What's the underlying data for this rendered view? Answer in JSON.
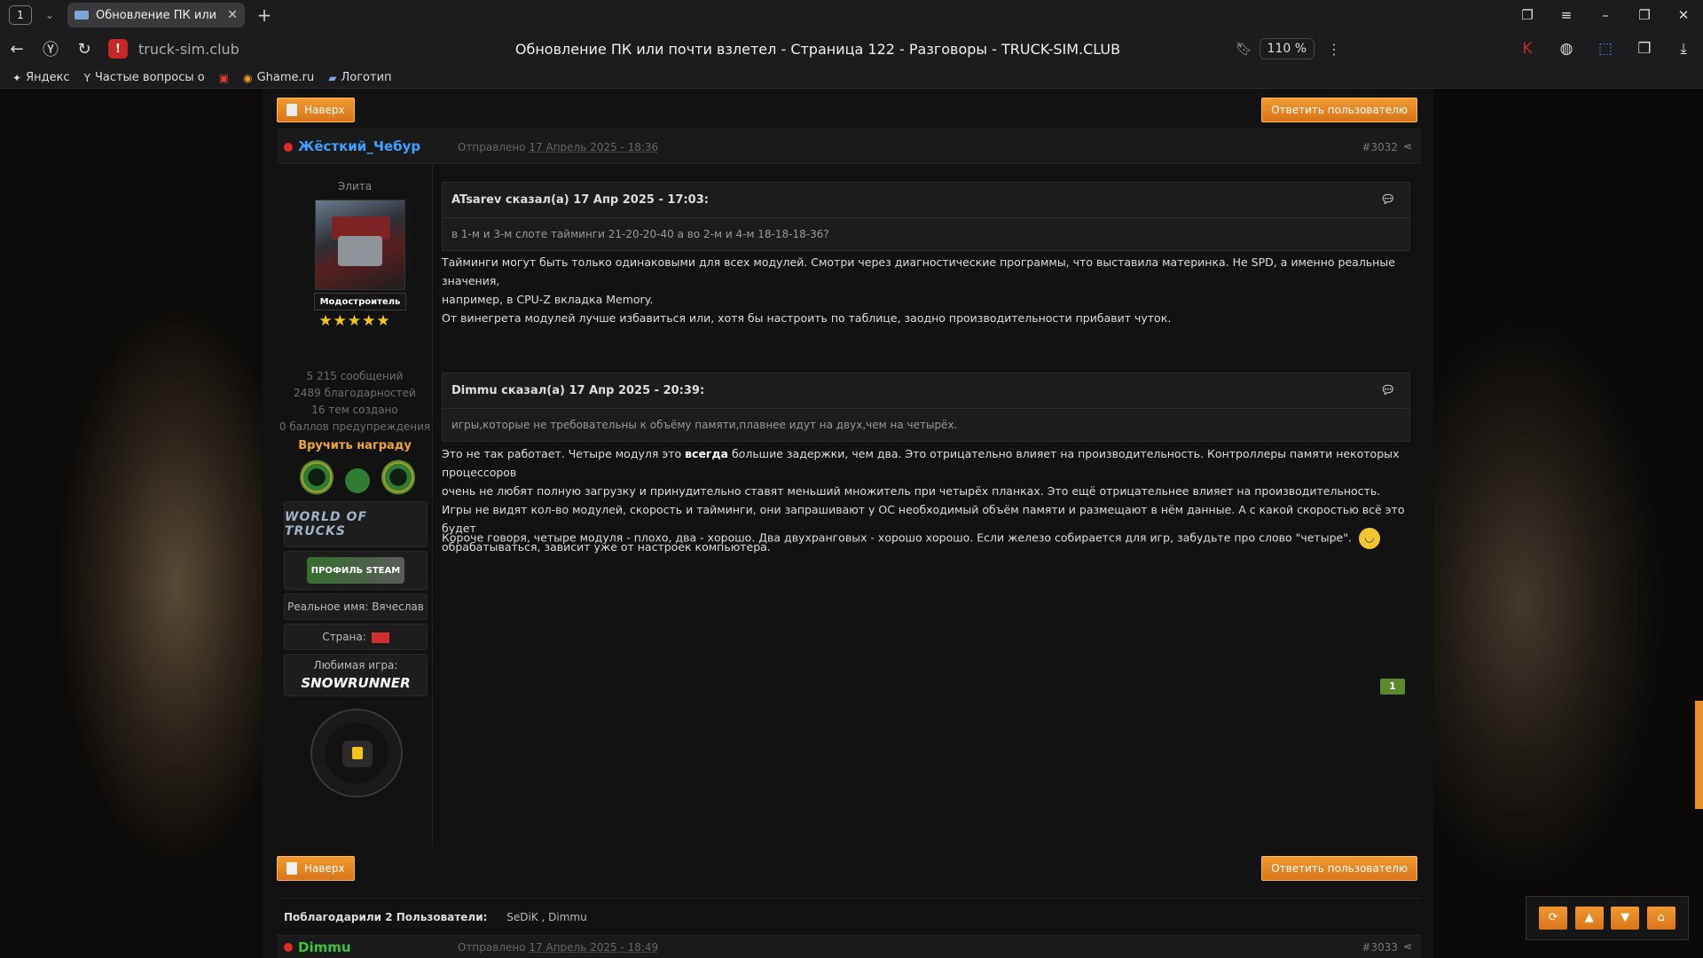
{
  "browser": {
    "tab_count": "1",
    "tab_title": "Обновление ПК или по",
    "url_domain": "truck-sim.club",
    "page_title": "Обновление ПК или почти взлетел - Страница 122 - Разговоры - TRUCK-SIM.CLUB",
    "zoom": "110 %",
    "bookmarks": [
      {
        "label": "Яндекс",
        "icon": "yandex-icon"
      },
      {
        "label": "Частые вопросы о",
        "icon": "yandex-browser-icon"
      },
      {
        "label": "",
        "icon": "bookmark-square-icon"
      },
      {
        "label": "Ghame.ru",
        "icon": "ghame-icon"
      },
      {
        "label": "Логотип",
        "icon": "link-icon"
      }
    ]
  },
  "forum": {
    "top_button": "Наверх",
    "reply_button": "Ответить пользователю",
    "post": {
      "author": "Жёсткий_Чебур",
      "sent_prefix": "Отправлено",
      "sent_date": "17 Апрель 2025 - 18:36",
      "number": "#3032",
      "profile": {
        "rank": "Элита",
        "badge": "Модостроитель",
        "stars": "★★★★★",
        "messages": "5 215 сообщений",
        "thanks": "2489 благодарностей",
        "topics": "16 тем создано",
        "warnings": "0 баллов предупреждения",
        "award_link": "Вручить награду",
        "wot_logo": "WORLD OF TRUCKS",
        "steam_logo": "ПРОФИЛЬ STEAM",
        "real_name": "Реальное имя: Вячеслав",
        "country": "Страна:",
        "fav_game_label": "Любимая игра:",
        "fav_game": "SNOWRUNNER"
      },
      "quote1_head": "ATsarev сказал(а) 17 Апр 2025 - 17:03:",
      "quote1_text": "в 1-м и 3-м слоте тайминги 21-20-20-40 а во 2-м и 4-м 18-18-18-36?",
      "reply1_line1": "Тайминги могут быть только одинаковыми для всех модулей. Смотри через диагностические программы, что выставила материнка. Не SPD, а именно реальные значения,",
      "reply1_line2": "например, в CPU-Z вкладка Memory.",
      "reply1_line3": "От винегрета модулей лучше избавиться или, хотя бы настроить по таблице, заодно производительности прибавит чуток.",
      "quote2_head": "Dimmu сказал(а) 17 Апр 2025 - 20:39:",
      "quote2_text": "игры,которые не требовательны к объёму памяти,плавнее идут на двух,чем на четырёх.",
      "reply2_pre": "Это не так работает. Четыре модуля это ",
      "reply2_bold1": "всегда",
      "reply2_mid": " б",
      "reply2_italic": "о",
      "reply2_post": "льшие задержки, чем два. Это отрицательно влияет на производительность. Контроллеры памяти некоторых процессоров",
      "reply2_line2": "очень не любят полную загрузку и принудительно ставят меньший множитель при четырёх планках. Это ещё отрицательнее влияет на производительность.",
      "reply2_line3": "Игры не видят кол-во модулей, скорость и тайминги, они запрашивают у ОС необходимый объём памяти и размещают в нём данные. А с какой скоростью всё это будет",
      "reply2_line4": "обрабатываться, зависит уже от настроек компьютера.",
      "reply3": "Короче говоря, четыре модуля - плохо, два - хорошо. Два двухранговых - хорошо хорошо. Если железо собирается для игр, забудьте про слово \"четыре\".",
      "reputation": "1"
    },
    "thanks_label": "Поблагодарили 2 Пользователи:",
    "thanks_users": "SeDiK , Dimmu",
    "next_post": {
      "author": "Dimmu",
      "sent_prefix": "Отправлено",
      "sent_date": "17 Апрель 2025 - 18:49",
      "number": "#3033"
    }
  },
  "colors": {
    "accent_orange": "#e8912a",
    "author_blue": "#3ea0ff",
    "author_green": "#39c43a",
    "award_gold": "#f0a830"
  }
}
